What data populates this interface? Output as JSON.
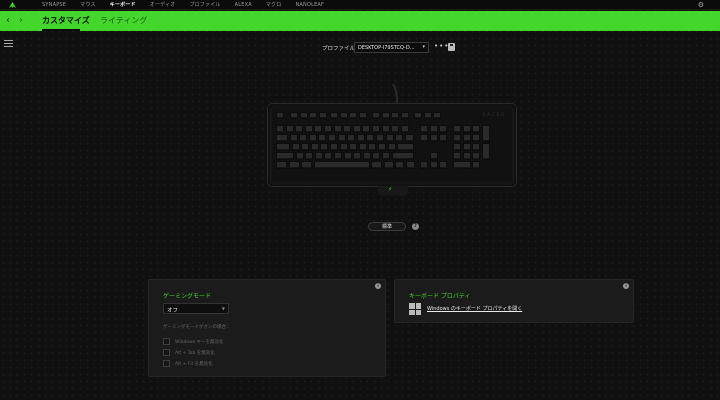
{
  "topnav": {
    "items": [
      "SYNAPSE",
      "マウス",
      "キーボード",
      "オーディオ",
      "プロファイル",
      "ALEXA",
      "マクロ",
      "NANOLEAF"
    ],
    "active_index": 2
  },
  "icons": {
    "logo": "razer-logo-icon",
    "settings": "gear-icon",
    "back": "chevron-left-icon",
    "forward": "chevron-right-icon",
    "menu": "hamburger-icon",
    "more": "more-icon",
    "save": "save-icon",
    "help": "help-icon",
    "windows": "windows-icon"
  },
  "tabs": [
    {
      "label": "カスタマイズ",
      "active": true
    },
    {
      "label": "ライティング",
      "active": false
    }
  ],
  "profile": {
    "label": "プロファイル",
    "value": "DESKTOP-I79STCQ-D..."
  },
  "keyboard": {
    "brand": "RAZER"
  },
  "standard_button": "標準",
  "gaming_mode": {
    "title": "ゲーミングモード",
    "value": "オフ",
    "hint": "ゲーミングモードがオンの場合：",
    "options": [
      {
        "label": "Windows キーを無効化",
        "checked": false
      },
      {
        "label": "Alt + Tab を無効化",
        "checked": false
      },
      {
        "label": "Alt + F4 を無効化",
        "checked": false
      }
    ]
  },
  "keyboard_properties": {
    "title": "キーボード プロパティ",
    "link": "Windows のキーボード プロパティを開く"
  },
  "colors": {
    "accent": "#44d62c",
    "background": "#101010",
    "panel": "#1b1b1b"
  }
}
